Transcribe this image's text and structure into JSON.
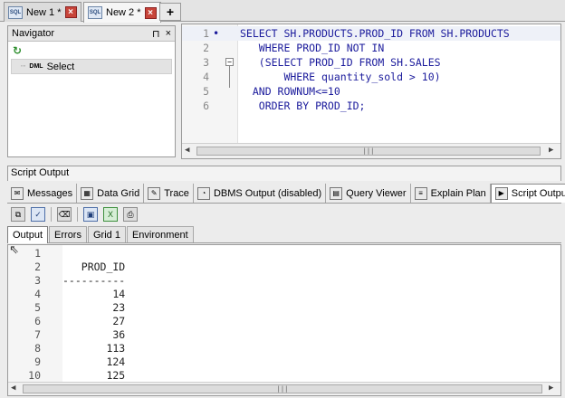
{
  "doc_tabs": [
    {
      "label": "New 1 *",
      "icon": "sql-icon",
      "active": false
    },
    {
      "label": "New 2 *",
      "icon": "sql-icon",
      "active": true
    }
  ],
  "add_tab_label": "+",
  "navigator": {
    "title": "Navigator",
    "pin_glyph": "⊓",
    "close_glyph": "×",
    "item_prefix": "DML",
    "item_label": "Select"
  },
  "editor": {
    "lines": [
      {
        "num": "1",
        "text": "SELECT SH.PRODUCTS.PROD_ID FROM SH.PRODUCTS"
      },
      {
        "num": "2",
        "text": "   WHERE PROD_ID NOT IN"
      },
      {
        "num": "3",
        "text": "   (SELECT PROD_ID FROM SH.SALES"
      },
      {
        "num": "4",
        "text": "       WHERE quantity_sold > 10)"
      },
      {
        "num": "5",
        "text": "  AND ROWNUM<=10"
      },
      {
        "num": "6",
        "text": "   ORDER BY PROD_ID;"
      }
    ],
    "scroll_grip": "|||"
  },
  "script_output": {
    "title": "Script Output",
    "panel_tabs": [
      {
        "label": "Messages",
        "icon": "messages-icon"
      },
      {
        "label": "Data Grid",
        "icon": "data-grid-icon"
      },
      {
        "label": "Trace",
        "icon": "trace-icon"
      },
      {
        "label": "DBMS Output (disabled)",
        "icon": "dbms-output-icon"
      },
      {
        "label": "Query Viewer",
        "icon": "query-viewer-icon"
      },
      {
        "label": "Explain Plan",
        "icon": "explain-plan-icon"
      },
      {
        "label": "Script Output",
        "icon": "script-output-icon"
      }
    ],
    "toolbar_icons": [
      "copy-icon",
      "check-format-icon",
      "clear-icon",
      "save-icon",
      "excel-icon",
      "print-icon"
    ],
    "sub_tabs": [
      "Output",
      "Errors",
      "Grid 1",
      "Environment"
    ],
    "output_lines": [
      {
        "num": "1",
        "text": ""
      },
      {
        "num": "2",
        "text": "   PROD_ID"
      },
      {
        "num": "3",
        "text": "----------"
      },
      {
        "num": "4",
        "text": "        14"
      },
      {
        "num": "5",
        "text": "        23"
      },
      {
        "num": "6",
        "text": "        27"
      },
      {
        "num": "7",
        "text": "        36"
      },
      {
        "num": "8",
        "text": "       113"
      },
      {
        "num": "9",
        "text": "       124"
      },
      {
        "num": "10",
        "text": "       125"
      }
    ],
    "scroll_grip": "|||"
  }
}
